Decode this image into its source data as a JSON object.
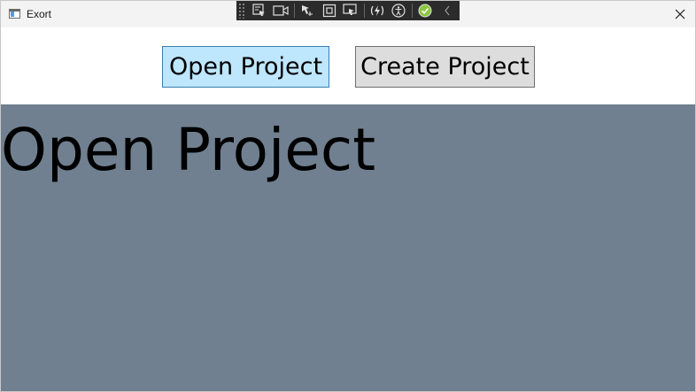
{
  "window": {
    "title": "Exort",
    "colors": {
      "titlebar": "#f3f3f3",
      "header": "#ffffff",
      "content_background": "#708090"
    }
  },
  "debug_toolbar": {
    "tools": [
      {
        "icon": "select-element-icon"
      },
      {
        "icon": "video-camera-icon"
      },
      {
        "icon": "display-layout-adorners-icon"
      },
      {
        "icon": "track-focus-icon"
      },
      {
        "icon": "select-element-in-app-icon"
      },
      {
        "icon": "hot-reload-icon"
      },
      {
        "icon": "accessibility-icon"
      },
      {
        "icon": "binding-check-ok-icon"
      },
      {
        "icon": "collapse-chevron-icon"
      }
    ]
  },
  "header": {
    "open_project_label": "Open Project",
    "create_project_label": "Create Project",
    "colors": {
      "open_button_bg": "#bee6fd",
      "open_button_border": "#3c7fb1",
      "create_button_bg": "#dddddd",
      "create_button_border": "#707070"
    }
  },
  "content": {
    "heading": "Open Project"
  }
}
